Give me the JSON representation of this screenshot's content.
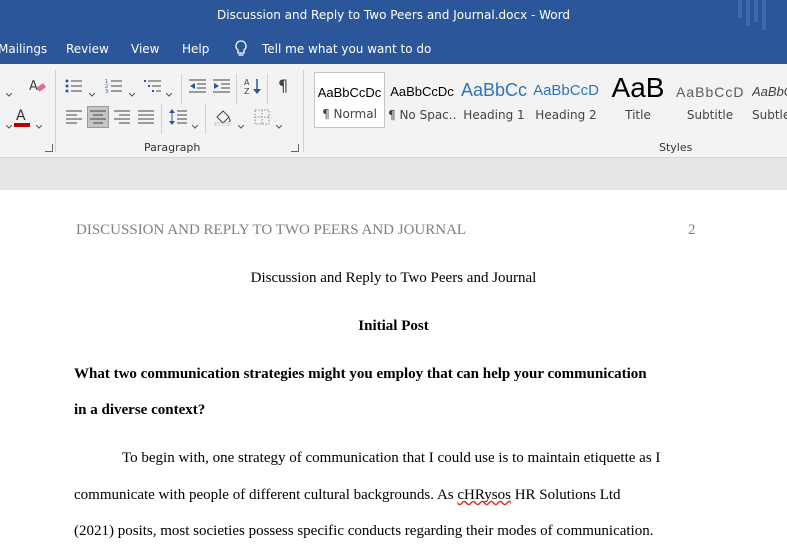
{
  "window": {
    "title": "Discussion and Reply to Two Peers and Journal.docx  -  Word"
  },
  "menu": {
    "items": [
      "Mailings",
      "Review",
      "View",
      "Help"
    ],
    "tell_me": "Tell me what you want to do"
  },
  "ribbon": {
    "paragraph_group": "Paragraph",
    "styles_group": "Styles",
    "styles": [
      {
        "sample": "AaBbCcDc",
        "name": "¶ Normal"
      },
      {
        "sample": "AaBbCcDc",
        "name": "¶ No Spac..."
      },
      {
        "sample": "AaBbCc",
        "name": "Heading 1"
      },
      {
        "sample": "AaBbCcD",
        "name": "Heading 2"
      },
      {
        "sample": "AaB",
        "name": "Title"
      },
      {
        "sample": "AaBbCcD",
        "name": "Subtitle"
      },
      {
        "sample": "AaBbC",
        "name": "Subtle"
      }
    ],
    "colors": {
      "font_color_underline": "#c00000",
      "accent": "#2b579a"
    }
  },
  "document": {
    "running_head": "DISCUSSION AND REPLY TO TWO PEERS AND JOURNAL",
    "page_number": "2",
    "title": "Discussion and Reply to Two Peers and Journal",
    "section_heading": "Initial Post",
    "question_line1": "What two communication strategies might you employ that can help your communication",
    "question_line2": "in a diverse context?",
    "body_line1": "To begin with, one strategy of communication that I could use is to maintain etiquette as I",
    "body_line2_pre": "communicate with people of different cultural backgrounds. As ",
    "body_line2_err": "cHRysos",
    "body_line2_post": " HR Solutions Ltd",
    "body_line3": "(2021) posits, most societies possess specific conducts regarding their modes of communication."
  }
}
